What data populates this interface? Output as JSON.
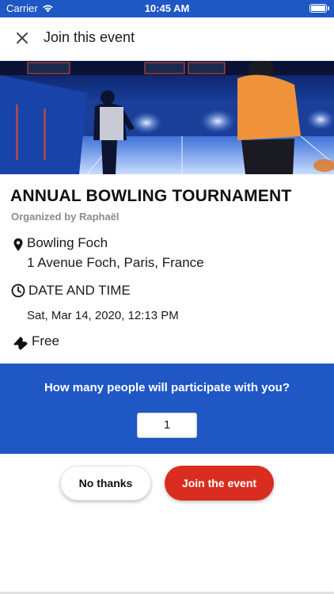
{
  "status_bar": {
    "carrier": "Carrier",
    "time": "10:45 AM",
    "wifi_icon": "wifi-icon",
    "battery_icon": "battery-icon"
  },
  "nav": {
    "close_icon": "close-icon",
    "title": "Join this event"
  },
  "hero": {
    "description_icon": "event-photo",
    "accent_color": "#1f57c4"
  },
  "event": {
    "title": "ANNUAL BOWLING TOURNAMENT",
    "organizer": "Organized by Raphaël",
    "venue_icon": "location-pin-icon",
    "venue_name": "Bowling Foch",
    "venue_address": "1 Avenue Foch, Paris, France",
    "datetime_icon": "clock-icon",
    "datetime_label": "DATE AND TIME",
    "datetime_value": "Sat, Mar 14, 2020, 12:13 PM",
    "price_icon": "ticket-icon",
    "price": "Free"
  },
  "participation": {
    "question": "How many people will participate with you?",
    "count_value": "1",
    "background_color": "#1f57c4"
  },
  "actions": {
    "decline_label": "No thanks",
    "join_label": "Join the event",
    "join_color": "#d92e1f"
  }
}
